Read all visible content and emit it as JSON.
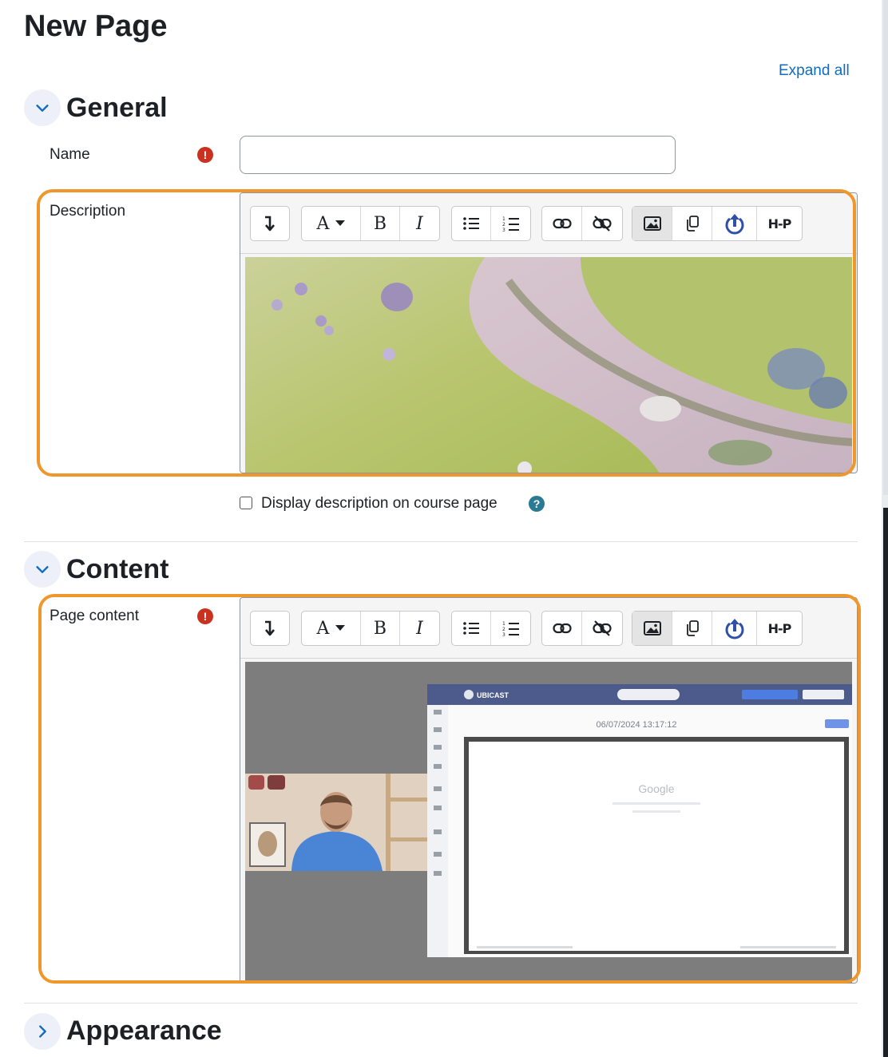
{
  "page": {
    "title": "New Page",
    "expand_all": "Expand all"
  },
  "sections": {
    "general": {
      "title": "General"
    },
    "content": {
      "title": "Content"
    },
    "appearance": {
      "title": "Appearance"
    }
  },
  "fields": {
    "name": {
      "label": "Name",
      "value": ""
    },
    "description": {
      "label": "Description"
    },
    "display_description": {
      "label": "Display description on course page",
      "checked": false
    },
    "page_content": {
      "label": "Page content"
    }
  },
  "toolbar": {
    "font_glyph": "A",
    "bold_glyph": "B",
    "italic_glyph": "I",
    "h5p_label": "H-P"
  },
  "video_screen": {
    "brand": "UBICAST",
    "timestamp": "06/07/2024 13:17:12",
    "search_text": "Google"
  },
  "colors": {
    "accent_link": "#0f6cbf",
    "required_icon": "#ca3120",
    "help_icon": "#2b7a94",
    "highlight_border": "#f0972c"
  }
}
